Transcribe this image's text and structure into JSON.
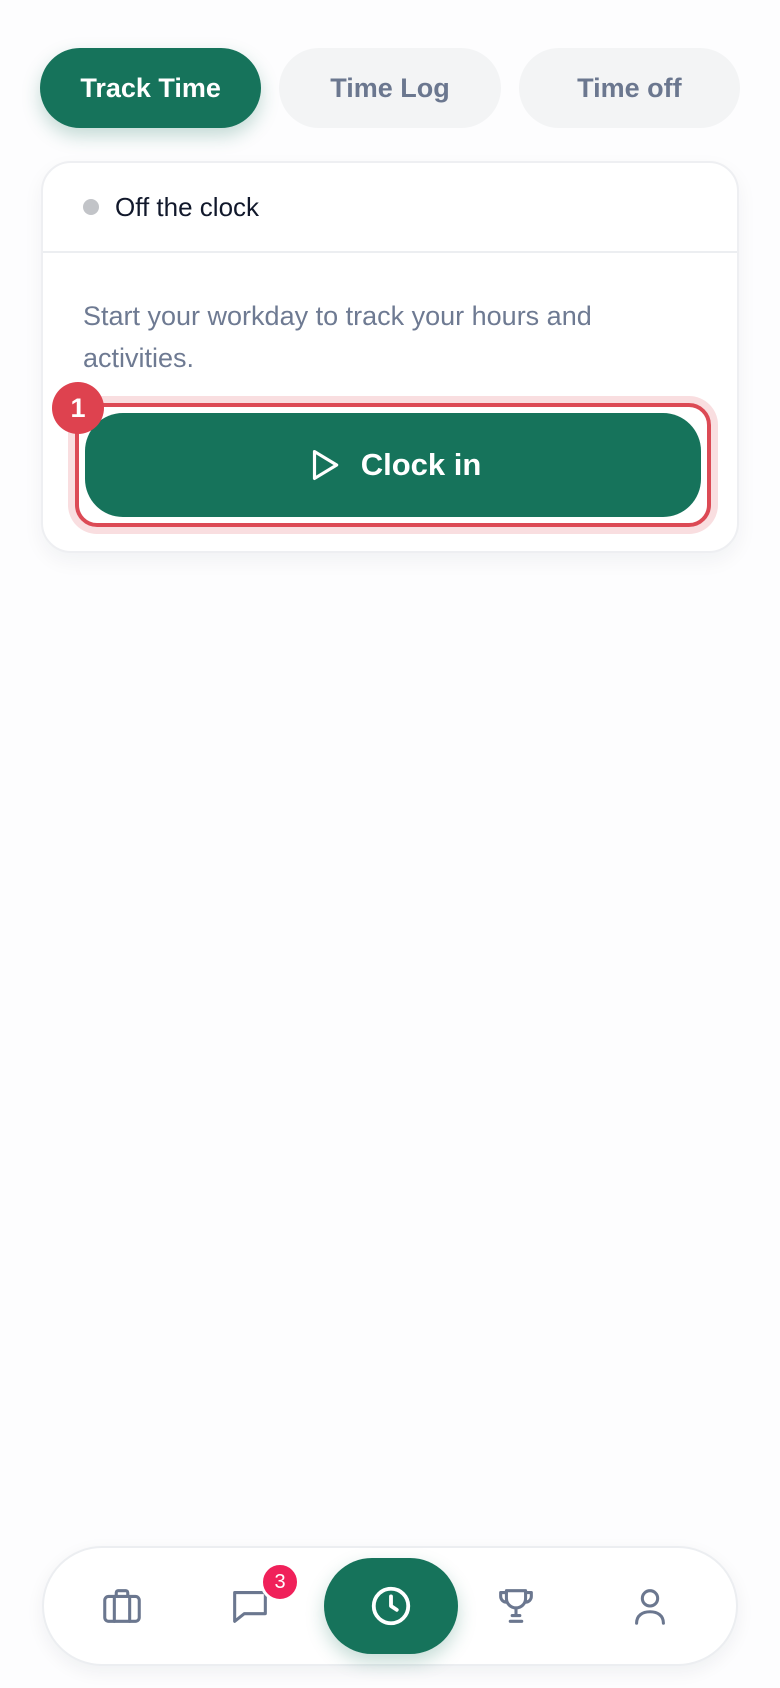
{
  "tabs": [
    {
      "label": "Track Time",
      "active": true
    },
    {
      "label": "Time Log",
      "active": false
    },
    {
      "label": "Time off",
      "active": false
    }
  ],
  "status": {
    "label": "Off the clock",
    "dot_color": "#c2c4c8"
  },
  "card": {
    "description": "Start your workday to track your hours and activities."
  },
  "clock_button": {
    "label": "Clock in",
    "icon": "play-icon"
  },
  "annotation": {
    "marker": "1"
  },
  "bottom_nav": {
    "items": [
      {
        "icon": "briefcase-icon"
      },
      {
        "icon": "chat-icon",
        "badge": "3"
      },
      {
        "icon": "clock-icon",
        "active": true
      },
      {
        "icon": "trophy-icon"
      },
      {
        "icon": "user-icon"
      }
    ]
  },
  "colors": {
    "accent": "#16735b",
    "badge": "#f0215a",
    "highlight": "#dc4a55"
  }
}
